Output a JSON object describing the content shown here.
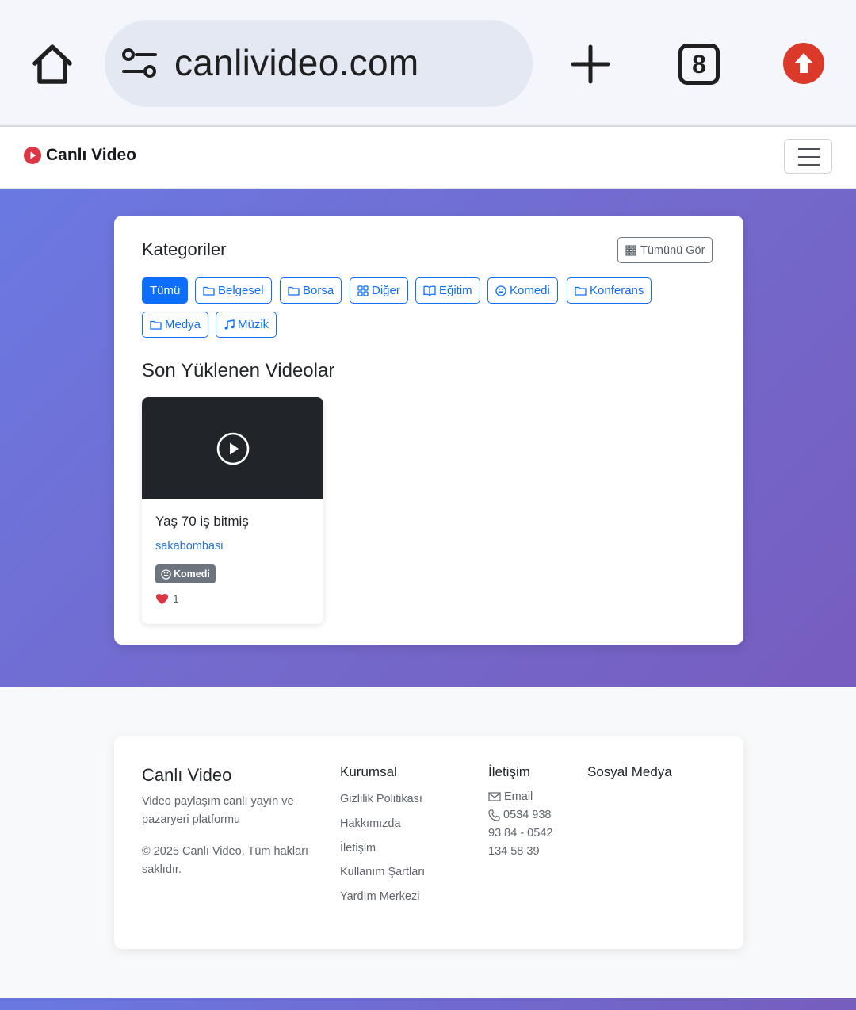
{
  "browser": {
    "url": "canlivideo.com",
    "tab_count": "8"
  },
  "navbar": {
    "brand": "Canlı Video"
  },
  "categories": {
    "title": "Kategoriler",
    "see_all": "Tümünü Gör",
    "items": [
      {
        "label": "Tümü",
        "icon": "none",
        "active": true
      },
      {
        "label": "Belgesel",
        "icon": "folder-icon"
      },
      {
        "label": "Borsa",
        "icon": "folder-icon"
      },
      {
        "label": "Diğer",
        "icon": "grid-icon"
      },
      {
        "label": "Eğitim",
        "icon": "book-icon"
      },
      {
        "label": "Komedi",
        "icon": "smile-icon"
      },
      {
        "label": "Konferans",
        "icon": "folder-icon"
      },
      {
        "label": "Medya",
        "icon": "folder-icon"
      },
      {
        "label": "Müzik",
        "icon": "music-icon"
      }
    ]
  },
  "recent": {
    "title": "Son Yüklenen Videolar",
    "videos": [
      {
        "title": "Yaş 70 iş bitmiş",
        "author": "sakabombasi",
        "category": "Komedi",
        "likes": "1"
      }
    ]
  },
  "footer": {
    "brand": "Canlı Video",
    "description": "Video paylaşım canlı yayın ve pazaryeri platformu",
    "copyright": "© 2025 Canlı Video. Tüm hakları saklıdır.",
    "corporate": {
      "title": "Kurumsal",
      "links": [
        "Gizlilik Politikası",
        "Hakkımızda",
        "İletişim",
        "Kullanım Şartları",
        "Yardım Merkezi"
      ]
    },
    "contact": {
      "title": "İletişim",
      "email": "Email",
      "phone_line1": "0534 938",
      "phone_line2": "93 84 - 0542",
      "phone_line3": "134 58 39"
    },
    "social": {
      "title": "Sosyal Medya"
    }
  },
  "colors": {
    "primary": "#0d6efd",
    "brand_red": "#dc3545",
    "hero_start": "#6a79e2",
    "hero_end": "#765dbf",
    "update_red": "#db3a2b"
  }
}
